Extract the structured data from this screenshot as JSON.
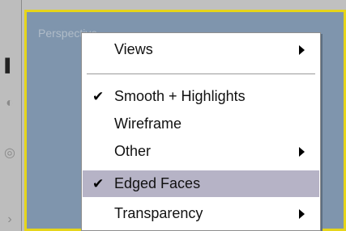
{
  "viewport": {
    "label": "Perspective"
  },
  "toolstrip": {
    "icons": [
      "bracket-icon",
      "eye-icon",
      "wheel-icon",
      "arrow-icon"
    ]
  },
  "menu": {
    "items": [
      {
        "label": "Views",
        "checked": false,
        "submenu": true,
        "highlighted": false
      },
      {
        "label": "Smooth + Highlights",
        "checked": true,
        "submenu": false,
        "highlighted": false
      },
      {
        "label": "Wireframe",
        "checked": false,
        "submenu": false,
        "highlighted": false
      },
      {
        "label": "Other",
        "checked": false,
        "submenu": true,
        "highlighted": false
      },
      {
        "label": "Edged Faces",
        "checked": true,
        "submenu": false,
        "highlighted": true
      },
      {
        "label": "Transparency",
        "checked": false,
        "submenu": true,
        "highlighted": false
      }
    ],
    "check_glyph": "✔"
  },
  "colors": {
    "viewport_bg": "#7f95ad",
    "viewport_border": "#e6d51a",
    "highlight": "#b6b3c6"
  }
}
